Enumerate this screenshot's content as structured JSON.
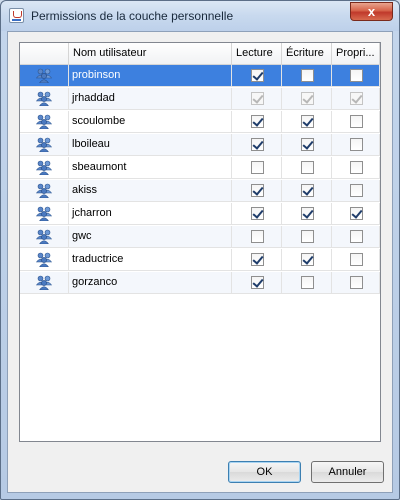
{
  "window": {
    "title": "Permissions de la couche personnelle",
    "close_symbol": "x"
  },
  "table": {
    "headers": {
      "icon": "",
      "user": "Nom utilisateur",
      "read": "Lecture",
      "write": "Écriture",
      "owner": "Propri..."
    },
    "rows": [
      {
        "user": "probinson",
        "read": true,
        "write": false,
        "owner": false,
        "selected": true,
        "disabled": false
      },
      {
        "user": "jrhaddad",
        "read": true,
        "write": true,
        "owner": true,
        "selected": false,
        "disabled": true
      },
      {
        "user": "scoulombe",
        "read": true,
        "write": true,
        "owner": false,
        "selected": false,
        "disabled": false
      },
      {
        "user": "lboileau",
        "read": true,
        "write": true,
        "owner": false,
        "selected": false,
        "disabled": false
      },
      {
        "user": "sbeaumont",
        "read": false,
        "write": false,
        "owner": false,
        "selected": false,
        "disabled": false
      },
      {
        "user": "akiss",
        "read": true,
        "write": true,
        "owner": false,
        "selected": false,
        "disabled": false
      },
      {
        "user": "jcharron",
        "read": true,
        "write": true,
        "owner": true,
        "selected": false,
        "disabled": false
      },
      {
        "user": "gwc",
        "read": false,
        "write": false,
        "owner": false,
        "selected": false,
        "disabled": false
      },
      {
        "user": "traductrice",
        "read": true,
        "write": true,
        "owner": false,
        "selected": false,
        "disabled": false
      },
      {
        "user": "gorzanco",
        "read": true,
        "write": false,
        "owner": false,
        "selected": false,
        "disabled": false
      }
    ],
    "row_icon": "user-group-icon",
    "colors": {
      "selection": "#3d80df",
      "alt_row": "#f4f7fc"
    }
  },
  "buttons": {
    "ok": "OK",
    "cancel": "Annuler"
  }
}
